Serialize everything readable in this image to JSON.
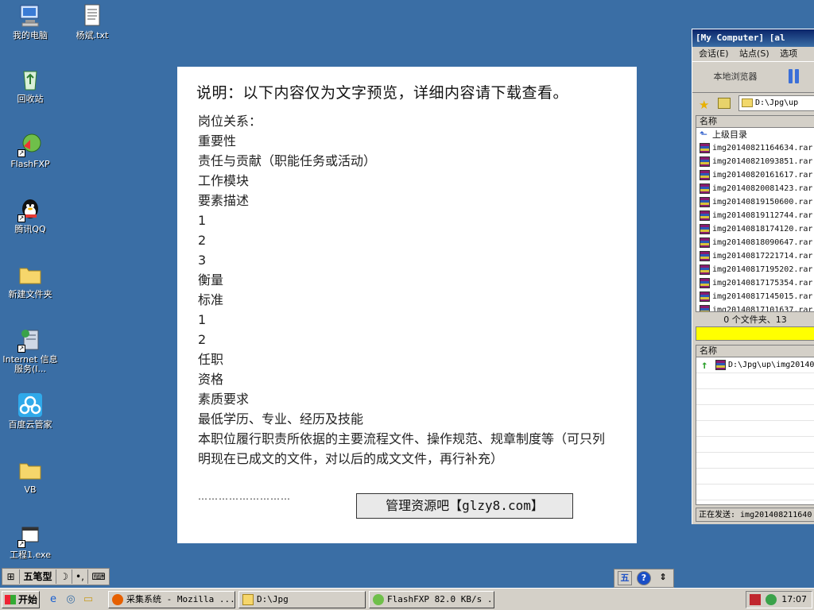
{
  "desktop": {
    "icons": [
      {
        "label": "我的电脑",
        "icon": "my-computer-icon"
      },
      {
        "label": "杨斌.txt",
        "icon": "text-file-icon"
      },
      {
        "label": "回收站",
        "icon": "recycle-bin-icon"
      },
      {
        "label": "FlashFXP",
        "icon": "flashfxp-icon"
      },
      {
        "label": "腾讯QQ",
        "icon": "qq-icon"
      },
      {
        "label": "新建文件夹",
        "icon": "folder-icon"
      },
      {
        "label": "Internet 信息服务(I...",
        "icon": "iis-icon"
      },
      {
        "label": "百度云管家",
        "icon": "baidu-cloud-icon"
      },
      {
        "label": "VB",
        "icon": "folder-icon"
      },
      {
        "label": "工程1.exe",
        "icon": "exe-icon"
      }
    ]
  },
  "document": {
    "title": "说明：以下内容仅为文字预览，详细内容请下载查看。",
    "lines": [
      "岗位关系：",
      "重要性",
      "责任与贡献（职能任务或活动）",
      "工作模块",
      "要素描述",
      "1",
      "2",
      "3",
      "衡量",
      "标准",
      "1",
      "2",
      "任职",
      "资格",
      "素质要求",
      "最低学历、专业、经历及技能",
      "本职位履行职责所依据的主要流程文件、操作规范、规章制度等（可只列明现在已成文的文件，对以后的成文文件，再行补充）"
    ],
    "dots": "………………………",
    "banner": "管理资源吧【glzy8.com】"
  },
  "ftp": {
    "title": "[My Computer]  [al",
    "menu": [
      "会话(E)",
      "站点(S)",
      "选项"
    ],
    "local_browser_label": "本地浏览器",
    "path": "D:\\Jpg\\up",
    "column_name": "名称",
    "parent_dir": "上级目录",
    "files": [
      "img20140821164634.rar",
      "img20140821093851.rar",
      "img20140820161617.rar",
      "img20140820081423.rar",
      "img20140819150600.rar",
      "img20140819112744.rar",
      "img20140818174120.rar",
      "img20140818090647.rar",
      "img20140817221714.rar",
      "img20140817195202.rar",
      "img20140817175354.rar",
      "img20140817145015.rar",
      "img20140817101637.rar"
    ],
    "summary": "0 个文件夹、13",
    "queue_column": "名称",
    "queue_item": "D:\\Jpg\\up\\img20140",
    "send_status": "正在发送: img201408211640"
  },
  "ime": {
    "mode": "五笔型",
    "moon": "☽",
    "punct": "•,",
    "kbd": "⌨"
  },
  "langbar": {
    "label": "五",
    "help": "?"
  },
  "taskbar": {
    "start_label": "开始",
    "tasks": [
      {
        "label": "采集系统 - Mozilla ...",
        "icon": "firefox-icon"
      },
      {
        "label": "D:\\Jpg",
        "icon": "folder-icon"
      },
      {
        "label": "FlashFXP 82.0 KB/s ...",
        "icon": "flashfxp-icon"
      }
    ],
    "clock": "17:07"
  }
}
